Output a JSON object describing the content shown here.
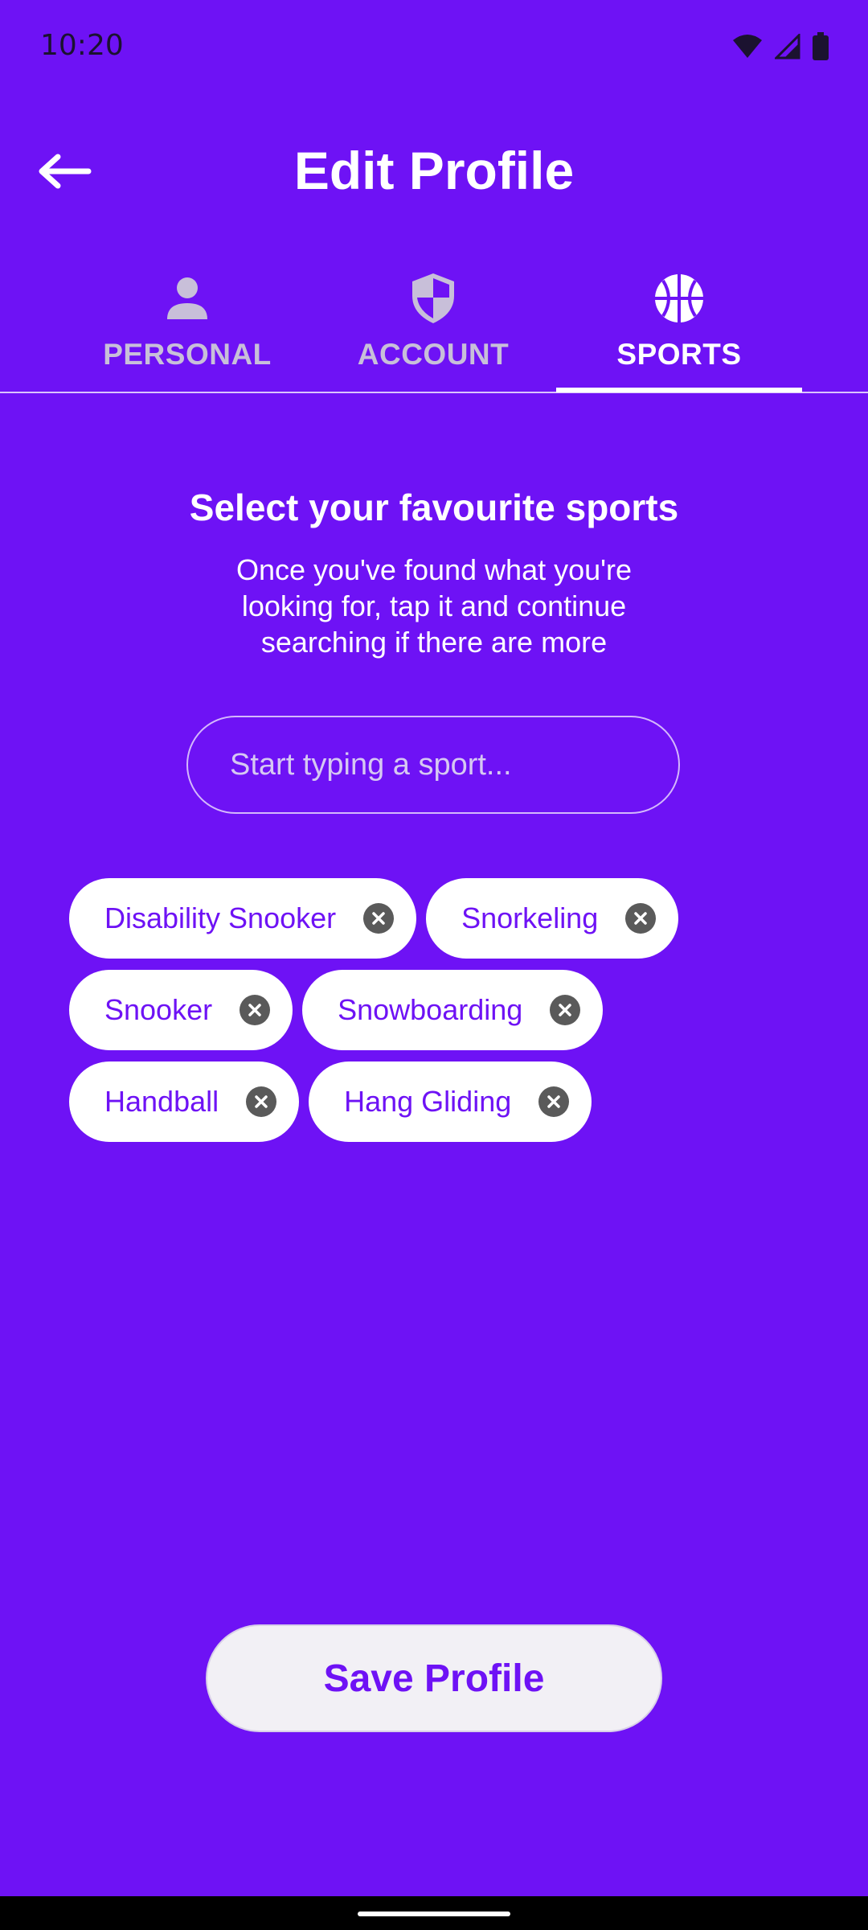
{
  "status_bar": {
    "time": "10:20",
    "icons": [
      "wifi-icon",
      "signal-icon",
      "battery-icon"
    ]
  },
  "header": {
    "title": "Edit Profile",
    "back_icon": "arrow-left-icon"
  },
  "tabs": [
    {
      "label": "PERSONAL",
      "icon": "person-icon",
      "active": false
    },
    {
      "label": "ACCOUNT",
      "icon": "shield-icon",
      "active": false
    },
    {
      "label": "SPORTS",
      "icon": "basketball-icon",
      "active": true
    }
  ],
  "content": {
    "heading": "Select your favourite sports",
    "subtitle": "Once you've found what you're looking for, tap it and continue searching if there are more"
  },
  "search": {
    "placeholder": "Start typing a sport...",
    "value": ""
  },
  "selected_sports": [
    "Disability Snooker",
    "Snorkeling",
    "Snooker",
    "Snowboarding",
    "Handball",
    "Hang Gliding"
  ],
  "save_button": {
    "label": "Save Profile"
  },
  "colors": {
    "background": "#6E12F5",
    "chip_background": "#FFFFFF",
    "chip_text": "#6E12F5",
    "tab_inactive": "#C8BFD9",
    "save_button_background": "#F2F0F5"
  }
}
